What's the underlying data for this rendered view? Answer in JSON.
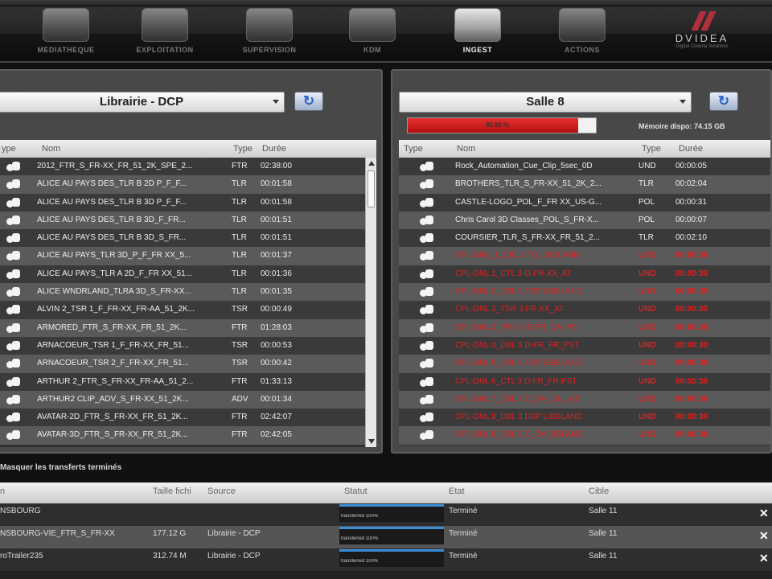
{
  "nav": {
    "items": [
      {
        "label": "MEDIATHEQUE",
        "icon": "media-library-icon"
      },
      {
        "label": "EXPLOITATION",
        "icon": "exploitation-icon"
      },
      {
        "label": "SUPERVISION",
        "icon": "supervision-icon"
      },
      {
        "label": "KDM",
        "icon": "kdm-icon"
      },
      {
        "label": "INGEST",
        "icon": "ingest-icon",
        "active": true
      },
      {
        "label": "ACTIONS",
        "icon": "actions-icon"
      }
    ],
    "logo": "DVIDEA",
    "logo_sub": "Digital Cinema Solutions"
  },
  "left_panel": {
    "source": "Librairie - DCP",
    "columns": [
      "ype",
      "Nom",
      "Type",
      "Durée"
    ],
    "rows": [
      {
        "name": "2012_FTR_S_FR-XX_FR_51_2K_SPE_2...",
        "type": "FTR",
        "duration": "02:38:00"
      },
      {
        "name": "ALICE AU PAYS DES_TLR B 2D P_F_F...",
        "type": "TLR",
        "duration": "00:01:58"
      },
      {
        "name": "ALICE AU PAYS DES_TLR B 3D P_F_F...",
        "type": "TLR",
        "duration": "00:01:58"
      },
      {
        "name": "ALICE AU PAYS DES_TLR B 3D_F_FR...",
        "type": "TLR",
        "duration": "00:01:51"
      },
      {
        "name": "ALICE AU PAYS DES_TLR B 3D_S_FR...",
        "type": "TLR",
        "duration": "00:01:51"
      },
      {
        "name": "ALICE AU PAYS_TLR 3D_P_F_FR XX_5...",
        "type": "TLR",
        "duration": "00:01:37"
      },
      {
        "name": "ALICE AU PAYS_TLR A 2D_F_FR XX_51...",
        "type": "TLR",
        "duration": "00:01:36"
      },
      {
        "name": "ALICE WNDRLAND_TLRA 3D_S_FR-XX...",
        "type": "TLR",
        "duration": "00:01:35"
      },
      {
        "name": "ALVIN 2_TSR 1_F_FR-XX_FR-AA_51_2K...",
        "type": "TSR",
        "duration": "00:00:49"
      },
      {
        "name": "ARMORED_FTR_S_FR-XX_FR_51_2K...",
        "type": "FTR",
        "duration": "01:28:03"
      },
      {
        "name": "ARNACOEUR_TSR 1_F_FR-XX_FR_51...",
        "type": "TSR",
        "duration": "00:00:53"
      },
      {
        "name": "ARNACOEUR_TSR 2_F_FR-XX_FR_51...",
        "type": "TSR",
        "duration": "00:00:42"
      },
      {
        "name": "ARTHUR 2_FTR_S_FR-XX_FR-AA_51_2...",
        "type": "FTR",
        "duration": "01:33:13"
      },
      {
        "name": "ARTHUR2 CLIP_ADV_S_FR-XX_51_2K...",
        "type": "ADV",
        "duration": "00:01:34"
      },
      {
        "name": "AVATAR-2D_FTR_S_FR-XX_FR_51_2K...",
        "type": "FTR",
        "duration": "02:42:07"
      },
      {
        "name": "AVATAR-3D_FTR_S_FR-XX_FR_51_2K...",
        "type": "FTR",
        "duration": "02:42:05"
      }
    ]
  },
  "right_panel": {
    "target": "Salle 8",
    "memory_percent": "95.96 %",
    "memory_fraction": 0.96,
    "memory_text": "Mémoire dispo: 74.15 GB",
    "columns": [
      "Type",
      "Nom",
      "Type",
      "Durée"
    ],
    "rows": [
      {
        "name": "Rock_Automation_Cue_Clip_5sec_0D",
        "type": "UND",
        "duration": "00:00:05",
        "red": false
      },
      {
        "name": "BROTHERS_TLR_S_FR-XX_51_2K_2...",
        "type": "TLR",
        "duration": "00:02:04",
        "red": false
      },
      {
        "name": "CASTLE-LOGO_POL_F_FR XX_US-G...",
        "type": "POL",
        "duration": "00:00:31",
        "red": false
      },
      {
        "name": "Chris Carol 3D Classes_POL_S_FR-X...",
        "type": "POL",
        "duration": "00:00:07",
        "red": false
      },
      {
        "name": "COURSIER_TLR_S_FR-XX_FR_51_2...",
        "type": "TLR",
        "duration": "00:02:10",
        "red": false
      },
      {
        "name": "CPL-DNL_1_DBL 2 TO LIBELAND",
        "type": "UND",
        "duration": "00:00:30",
        "red": true
      },
      {
        "name": "CPL-DNL 1_CTL 3-D-FR-XX_AT",
        "type": "UND",
        "duration": "00:00:30",
        "red": true
      },
      {
        "name": "CPL-DNL 2_DBL 3 DSP LIBELAND",
        "type": "UND",
        "duration": "00:00:30",
        "red": true
      },
      {
        "name": "CPL-DNL 2_TSR 3 FR-XX_AT",
        "type": "UND",
        "duration": "00:00:30",
        "red": true
      },
      {
        "name": "CPL-DNL 3_FR-1 3 D FR_DA_PS",
        "type": "UND",
        "duration": "00:00:30",
        "red": true
      },
      {
        "name": "CPL-DNL 4_DBL 3 D-FR_FR_PST",
        "type": "UND",
        "duration": "00:00:30",
        "red": true
      },
      {
        "name": "CPL-DNL 5_DBL 3 DSP LIBELAND",
        "type": "UND",
        "duration": "00:00:30",
        "red": true
      },
      {
        "name": "CPL-DNL 6_CTL 3 D-FR_FR-PST",
        "type": "UND",
        "duration": "00:00:30",
        "red": true
      },
      {
        "name": "CPL-DNL 7_DBL 3 D_DA_LBL_AS",
        "type": "UND",
        "duration": "00:00:30",
        "red": true
      },
      {
        "name": "CPL-DNL 8_DBL 3 DSP LIBELAND",
        "type": "UND",
        "duration": "00:00:30",
        "red": true
      },
      {
        "name": "CPL-DNL 9_DBL 3 D_DA_BELAND",
        "type": "UND",
        "duration": "00:00:30",
        "red": true
      }
    ]
  },
  "transfers": {
    "mask_label": "Masquer les transferts terminés",
    "columns": [
      "n",
      "Taille fichi",
      "Source",
      "Statut",
      "Etat",
      "Cible"
    ],
    "rows": [
      {
        "name": "NSBOURG",
        "size": "",
        "source": "",
        "status": "transferred 100%",
        "progress": 1.0,
        "state": "Terminé",
        "target": "Salle 11"
      },
      {
        "name": "NSBOURG-VIE_FTR_S_FR-XX",
        "size": "177.12 G",
        "source": "Librairie - DCP",
        "status": "transferred 100%",
        "progress": 1.0,
        "state": "Terminé",
        "target": "Salle 11"
      },
      {
        "name": "roTrailer235",
        "size": "312.74 M",
        "source": "Librairie - DCP",
        "status": "transferred 100%",
        "progress": 1.0,
        "state": "Terminé",
        "target": "Salle 11"
      }
    ]
  }
}
